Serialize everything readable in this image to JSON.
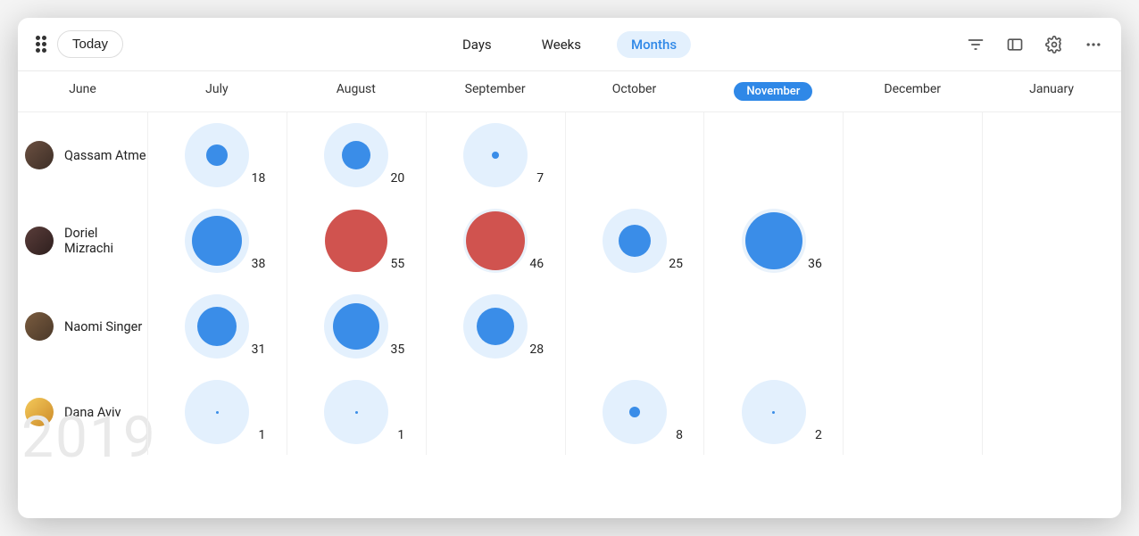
{
  "toolbar": {
    "today_label": "Today",
    "view_tabs": [
      "Days",
      "Weeks",
      "Months"
    ],
    "active_tab": "Months"
  },
  "header": {
    "months": [
      "June",
      "July",
      "August",
      "September",
      "October",
      "November",
      "December",
      "January"
    ],
    "selected_month": "November"
  },
  "year_watermark": "2019",
  "people": [
    {
      "name": "Qassam Atme",
      "avatar_class": "av1"
    },
    {
      "name": "Doriel Mizrachi",
      "avatar_class": "av2"
    },
    {
      "name": "Naomi Singer",
      "avatar_class": "av3"
    },
    {
      "name": "Dana Aviv",
      "avatar_class": "av4"
    }
  ],
  "chart_data": {
    "type": "bubble-matrix",
    "x_categories": [
      "June",
      "July",
      "August",
      "September",
      "October",
      "November",
      "December",
      "January"
    ],
    "y_categories": [
      "Qassam Atme",
      "Doriel Mizrachi",
      "Naomi Singer",
      "Dana Aviv"
    ],
    "colors": {
      "blue": "#3a8de8",
      "red": "#d0534f",
      "ring": "#e3f0fd"
    },
    "cells": [
      {
        "row": 0,
        "col": 1,
        "value": 18,
        "color": "blue",
        "core": 24,
        "ring": true
      },
      {
        "row": 0,
        "col": 2,
        "value": 20,
        "color": "blue",
        "core": 32,
        "ring": true
      },
      {
        "row": 0,
        "col": 3,
        "value": 7,
        "color": "blue",
        "core": 8,
        "ring": true
      },
      {
        "row": 1,
        "col": 1,
        "value": 38,
        "color": "blue",
        "core": 56,
        "ring": true
      },
      {
        "row": 1,
        "col": 2,
        "value": 55,
        "color": "red",
        "core": 70,
        "ring": false
      },
      {
        "row": 1,
        "col": 3,
        "value": 46,
        "color": "red",
        "core": 66,
        "ring": true,
        "ring_thin": true
      },
      {
        "row": 1,
        "col": 4,
        "value": 25,
        "color": "blue",
        "core": 36,
        "ring": true
      },
      {
        "row": 1,
        "col": 5,
        "value": 36,
        "color": "blue",
        "core": 64,
        "ring": true,
        "ring_thin": true
      },
      {
        "row": 2,
        "col": 1,
        "value": 31,
        "color": "blue",
        "core": 44,
        "ring": true
      },
      {
        "row": 2,
        "col": 2,
        "value": 35,
        "color": "blue",
        "core": 52,
        "ring": true
      },
      {
        "row": 2,
        "col": 3,
        "value": 28,
        "color": "blue",
        "core": 42,
        "ring": true
      },
      {
        "row": 3,
        "col": 1,
        "value": 1,
        "color": "blue",
        "core": 3,
        "ring": true
      },
      {
        "row": 3,
        "col": 2,
        "value": 1,
        "color": "blue",
        "core": 3,
        "ring": true
      },
      {
        "row": 3,
        "col": 4,
        "value": 8,
        "color": "blue",
        "core": 12,
        "ring": true
      },
      {
        "row": 3,
        "col": 5,
        "value": 2,
        "color": "blue",
        "core": 3,
        "ring": true
      }
    ]
  }
}
